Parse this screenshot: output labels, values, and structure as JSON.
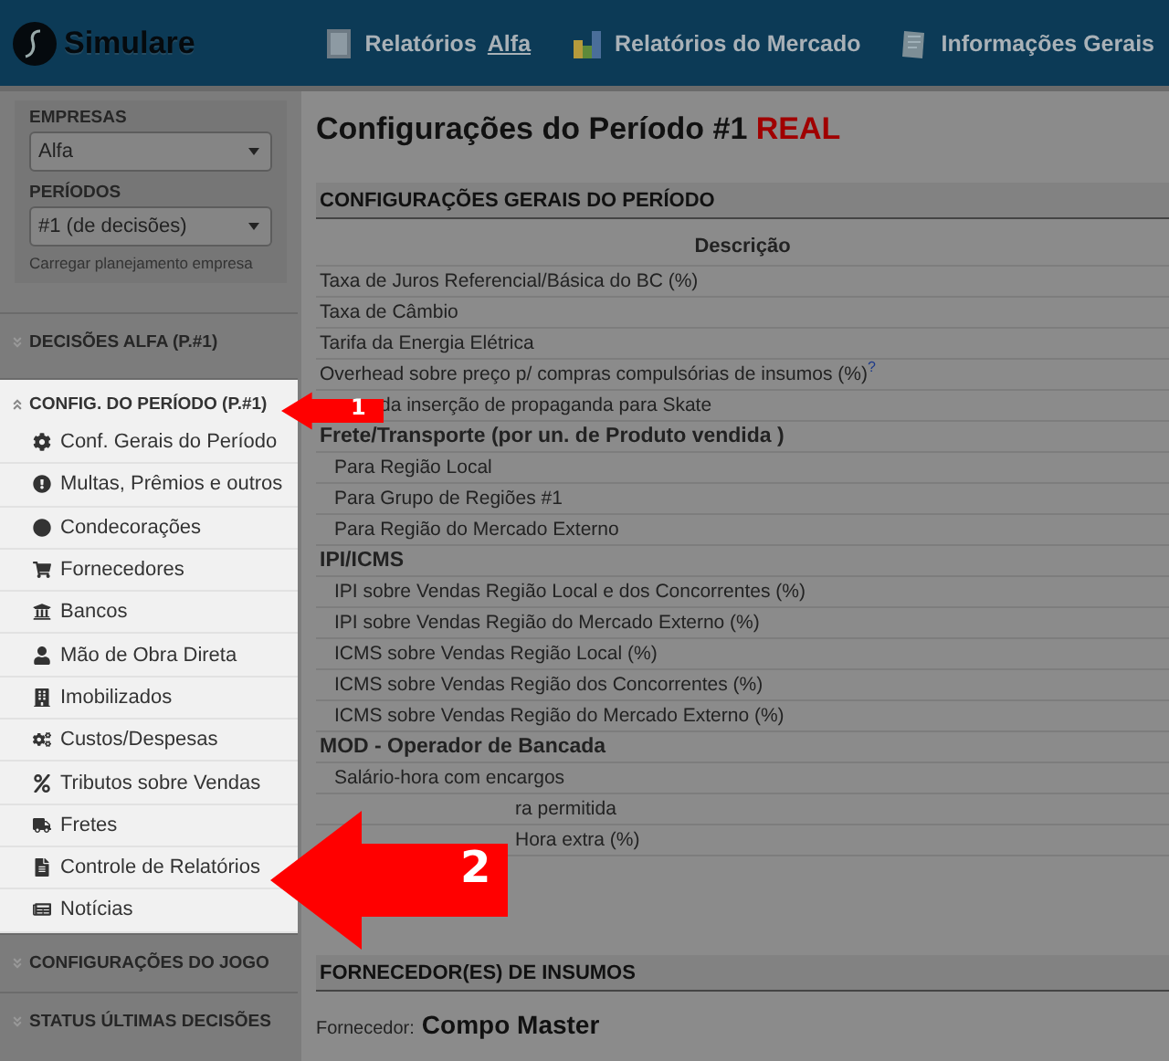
{
  "header": {
    "logo": "Simulare",
    "nav": [
      {
        "label": "Relatórios",
        "link": "Alfa"
      },
      {
        "label": "Relatórios do Mercado"
      },
      {
        "label": "Informações Gerais"
      }
    ]
  },
  "sidebar": {
    "empresas_label": "EMPRESAS",
    "empresa": "Alfa",
    "periodos_label": "PERÍODOS",
    "periodo": "#1 (de decisões)",
    "load_link": "Carregar planejamento empresa",
    "sections": [
      {
        "title": "DECISÕES ALFA (P.#1)",
        "expanded": false
      },
      {
        "title": "CONFIG. DO PERÍODO (P.#1)",
        "expanded": true,
        "items": [
          "Conf. Gerais do Período",
          "Multas, Prêmios e outros",
          "Condecorações",
          "Fornecedores",
          "Bancos",
          "Mão de Obra Direta",
          "Imobilizados",
          "Custos/Despesas",
          "Tributos sobre Vendas",
          "Fretes",
          "Controle de Relatórios",
          "Notícias"
        ]
      },
      {
        "title": "CONFIGURAÇÕES DO JOGO",
        "expanded": false
      },
      {
        "title": "STATUS ÚLTIMAS DECISÕES",
        "expanded": false
      }
    ]
  },
  "main": {
    "title": "Configurações do Período #1",
    "title_tag": "REAL",
    "general": {
      "heading": "CONFIGURAÇÕES GERAIS DO PERÍODO",
      "column": "Descrição",
      "rows": [
        {
          "kind": "item",
          "text": "Taxa de Juros Referencial/Básica do BC (%)"
        },
        {
          "kind": "item",
          "text": "Taxa de Câmbio"
        },
        {
          "kind": "item",
          "text": "Tarifa da Energia Elétrica"
        },
        {
          "kind": "item",
          "text": "Overhead sobre preço p/ compras compulsórias de insumos (%)$^{?}$"
        },
        {
          "kind": "partial",
          "text": "da inserção de propaganda para Skate"
        },
        {
          "kind": "group",
          "text": "Frete/Transporte (por un. de Produto vendida )"
        },
        {
          "kind": "subitem",
          "text": "Para Região Local"
        },
        {
          "kind": "subitem",
          "text": "Para Grupo de Regiões #1"
        },
        {
          "kind": "subitem",
          "text": "Para Região do Mercado Externo"
        },
        {
          "kind": "group",
          "text": "IPI/ICMS"
        },
        {
          "kind": "subitem",
          "text": "IPI sobre Vendas Região Local e dos Concorrentes (%)"
        },
        {
          "kind": "subitem",
          "text": "IPI sobre Vendas Região do Mercado Externo (%)"
        },
        {
          "kind": "subitem",
          "text": "ICMS sobre Vendas Região Local (%)"
        },
        {
          "kind": "subitem",
          "text": "ICMS sobre Vendas Região dos Concorrentes (%)"
        },
        {
          "kind": "subitem",
          "text": "ICMS sobre Vendas Região do Mercado Externo (%)"
        },
        {
          "kind": "group",
          "text": "MOD - Operador de Bancada"
        },
        {
          "kind": "subitem",
          "text": "Salário-hora com encargos"
        },
        {
          "kind": "subpartial",
          "text": "ra permitida"
        },
        {
          "kind": "subpartial",
          "text": "Hora extra (%)"
        }
      ]
    },
    "suppliers": {
      "heading": "FORNECEDOR(ES) DE INSUMOS",
      "label": "Fornecedor:",
      "value": "Compo Master"
    }
  },
  "annotations": [
    {
      "number": "1"
    },
    {
      "number": "2"
    }
  ]
}
